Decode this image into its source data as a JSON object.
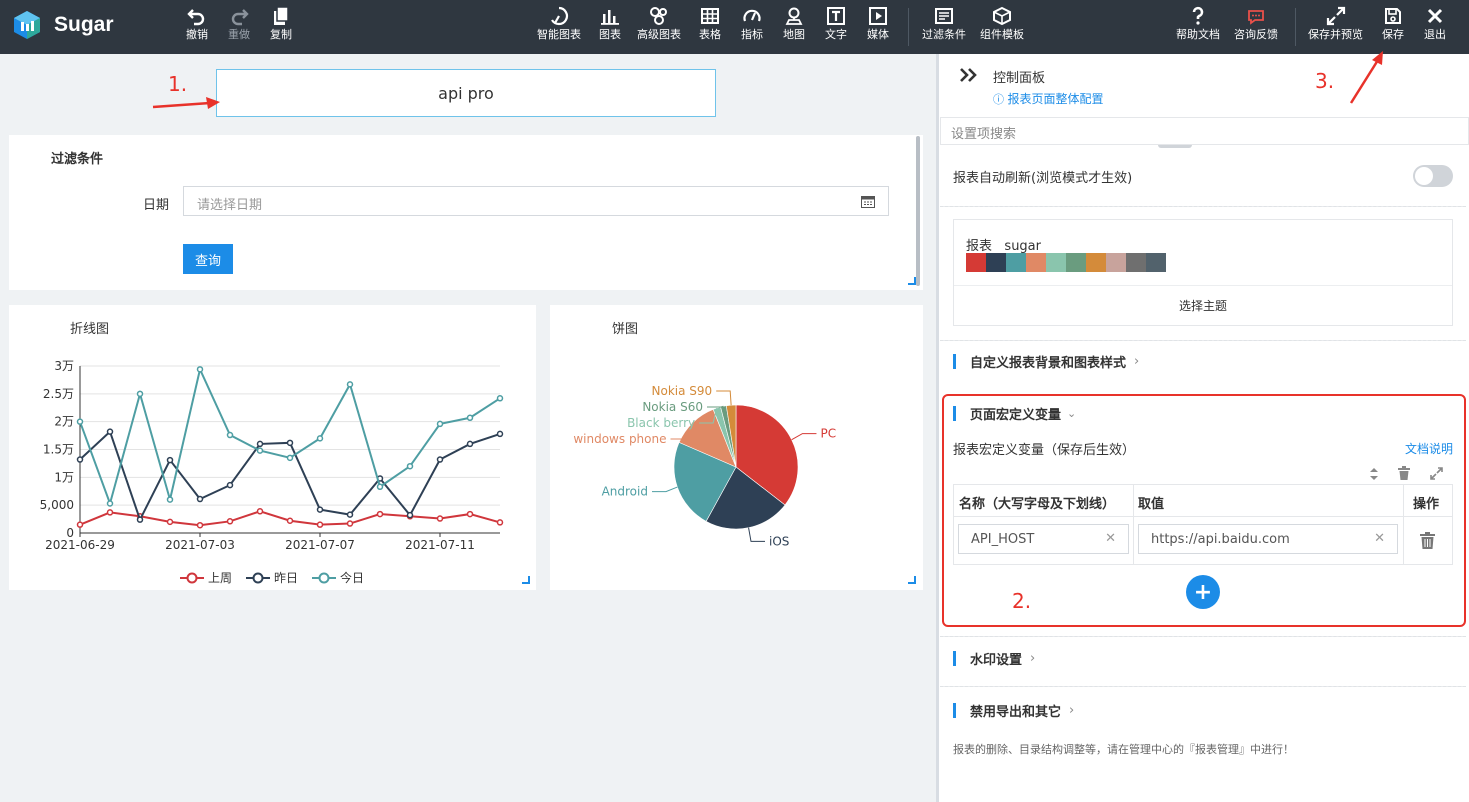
{
  "app": {
    "name": "Sugar"
  },
  "toolbar": {
    "undo": "撤销",
    "redo": "重做",
    "copy": "复制",
    "smart_chart": "智能图表",
    "chart": "图表",
    "advanced_chart": "高级图表",
    "table": "表格",
    "metric": "指标",
    "map": "地图",
    "text": "文字",
    "media": "媒体",
    "filter": "过滤条件",
    "component_template": "组件模板",
    "help": "帮助文档",
    "feedback": "咨询反馈",
    "save_preview": "保存并预览",
    "save": "保存",
    "exit": "退出"
  },
  "report": {
    "title": "api pro"
  },
  "filter_card": {
    "title": "过滤条件",
    "date_label": "日期",
    "date_placeholder": "请选择日期",
    "query_button": "查询"
  },
  "line_card": {
    "title": "折线图",
    "y_ticks": [
      "3万",
      "2.5万",
      "2万",
      "1.5万",
      "1万",
      "5,000",
      "0"
    ],
    "x_ticks": [
      "2021-06-29",
      "2021-07-03",
      "2021-07-07",
      "2021-07-11"
    ],
    "legend": [
      "上周",
      "昨日",
      "今日"
    ]
  },
  "pie_card": {
    "title": "饼图"
  },
  "chart_data": [
    {
      "type": "line",
      "x": [
        "2021-06-29",
        "2021-06-30",
        "2021-07-01",
        "2021-07-02",
        "2021-07-03",
        "2021-07-04",
        "2021-07-05",
        "2021-07-06",
        "2021-07-07",
        "2021-07-08",
        "2021-07-09",
        "2021-07-10",
        "2021-07-11",
        "2021-07-12",
        "2021-07-13"
      ],
      "ylim": [
        0,
        30000
      ],
      "series": [
        {
          "name": "上周",
          "color": "#d0363c",
          "values": [
            1500,
            3700,
            3000,
            2000,
            1400,
            2100,
            3900,
            2200,
            1500,
            1700,
            3400,
            3000,
            2600,
            3400,
            1900
          ]
        },
        {
          "name": "昨日",
          "color": "#2e4055",
          "values": [
            13200,
            18200,
            2400,
            13100,
            6100,
            8600,
            16000,
            16200,
            4200,
            3300,
            9800,
            3200,
            13200,
            16000,
            17800
          ]
        },
        {
          "name": "今日",
          "color": "#4e9ea3",
          "values": [
            20000,
            5300,
            25000,
            6000,
            29400,
            17600,
            14800,
            13500,
            17000,
            26700,
            8300,
            12000,
            19600,
            20700,
            24200
          ]
        }
      ]
    },
    {
      "type": "pie",
      "slices": [
        {
          "name": "PC",
          "value": 35.5,
          "color": "#d53a35"
        },
        {
          "name": "iOS",
          "value": 22.5,
          "color": "#2e4055"
        },
        {
          "name": "Android",
          "value": 23.5,
          "color": "#4e9ea3"
        },
        {
          "name": "windows phone",
          "value": 12.5,
          "color": "#e08965"
        },
        {
          "name": "Black berry",
          "value": 2.0,
          "color": "#8ac5ad"
        },
        {
          "name": "Nokia S60",
          "value": 1.5,
          "color": "#6a9c7f"
        },
        {
          "name": "Nokia S90",
          "value": 2.5,
          "color": "#d48b3a"
        }
      ]
    }
  ],
  "panel": {
    "title": "控制面板",
    "config_link": "报表页面整体配置",
    "search_placeholder": "设置项搜索",
    "auto_refresh": "报表自动刷新(浏览模式才生效)",
    "theme_label": "报表",
    "theme_name": "sugar",
    "theme_colors": [
      "#d53a35",
      "#2e4055",
      "#4e9ea3",
      "#e08965",
      "#8ac5ad",
      "#6a9c7f",
      "#d48b3a",
      "#c8a39c",
      "#6f6f6f",
      "#52626c"
    ],
    "choose_theme": "选择主题",
    "section_bg": "自定义报表背景和图表样式",
    "section_macro": "页面宏定义变量",
    "macro_desc": "报表宏定义变量（保存后生效）",
    "doc_link": "文档说明",
    "col_name": "名称（大写字母及下划线）",
    "col_value": "取值",
    "col_action": "操作",
    "var_name": "API_HOST",
    "var_value": "https://api.baidu.com",
    "section_watermark": "水印设置",
    "section_export": "禁用导出和其它",
    "footnote": "报表的删除、目录结构调整等，请在管理中心的『报表管理』中进行！"
  },
  "annotations": {
    "n1": "1.",
    "n2": "2.",
    "n3": "3."
  }
}
